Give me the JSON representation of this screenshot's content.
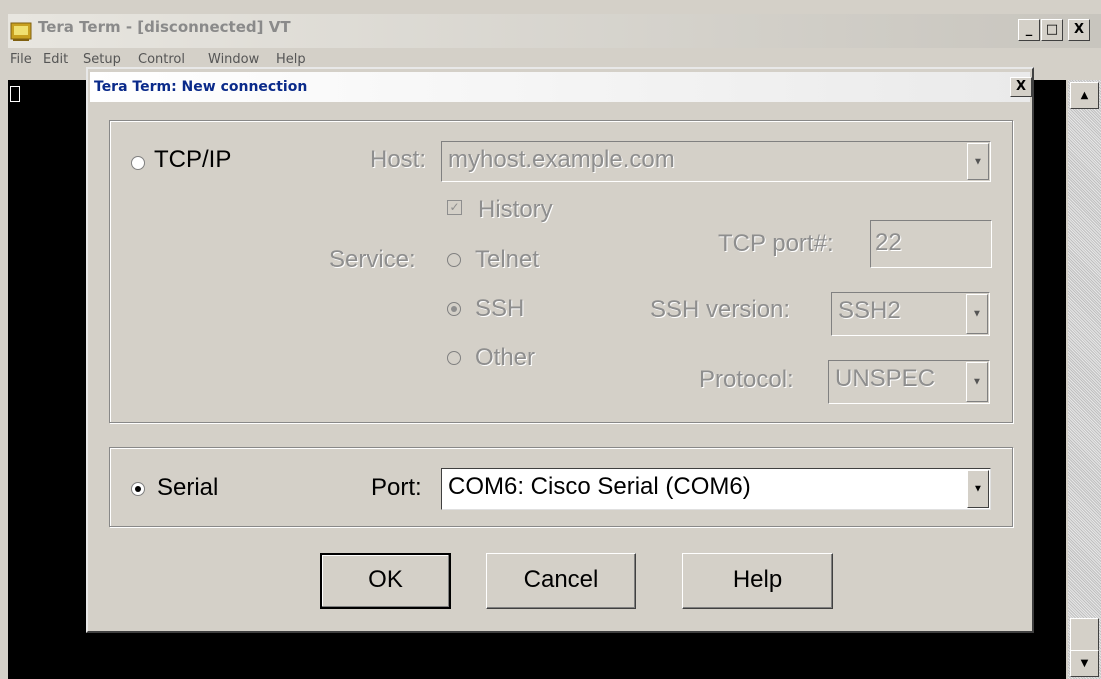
{
  "window": {
    "title": "Tera Term - [disconnected] VT",
    "controls": {
      "minimize": "_",
      "maximize": "□",
      "close": "X"
    },
    "menu": [
      "File",
      "Edit",
      "Setup",
      "Control",
      "Window",
      "Help"
    ]
  },
  "dialog": {
    "title": "Tera Term: New connection",
    "close": "X",
    "tcpip": {
      "label": "TCP/IP",
      "selected": false,
      "host_label": "Host:",
      "host_value": "myhost.example.com",
      "history_label": "History",
      "history_checked": true,
      "service_label": "Service:",
      "services": [
        {
          "label": "Telnet",
          "selected": false
        },
        {
          "label": "SSH",
          "selected": true
        },
        {
          "label": "Other",
          "selected": false
        }
      ],
      "tcp_port_label": "TCP port#:",
      "tcp_port_value": "22",
      "ssh_version_label": "SSH version:",
      "ssh_version_value": "SSH2",
      "protocol_label": "Protocol:",
      "protocol_value": "UNSPEC"
    },
    "serial": {
      "label": "Serial",
      "selected": true,
      "port_label": "Port:",
      "port_value": "COM6: Cisco Serial (COM6)"
    },
    "buttons": {
      "ok": "OK",
      "cancel": "Cancel",
      "help": "Help"
    }
  },
  "icons": {
    "app": "tera-term-icon",
    "dropdown": "chevron-down-icon",
    "scroll_up": "arrow-up-icon",
    "scroll_down": "arrow-down-icon"
  },
  "colors": {
    "terminal_bg": "#000000",
    "dialog_bg": "#d4d0c8",
    "disabled_text": "#8e8e8e",
    "dialog_title_text": "#0a2a8a"
  }
}
